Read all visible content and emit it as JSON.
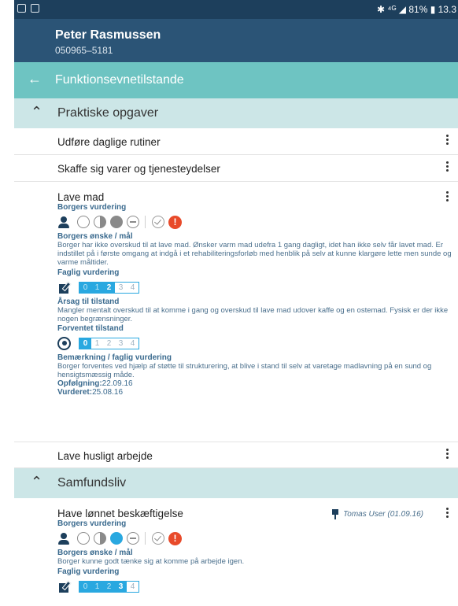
{
  "statusbar": {
    "right": "✱ ⁴ᴳ ◢ 81% ▮ 13.3"
  },
  "patient": {
    "name": "Peter Rasmussen",
    "cpr": "050965–5181"
  },
  "appbar": {
    "title": "Funktionsevnetilstande"
  },
  "sections": [
    {
      "label": "Praktiske opgaver"
    },
    {
      "label": "Samfundsliv"
    }
  ],
  "rows": {
    "daglige": "Udføre daglige rutiner",
    "varer": "Skaffe sig varer og tjenesteydelser",
    "husligt": "Lave husligt arbejde"
  },
  "lave_mad": {
    "title": "Lave mad",
    "borgers_vurdering": "Borgers vurdering",
    "onske_label": "Borgers ønske / mål",
    "onske_text": "Borger har ikke overskud til at lave mad. Ønsker varm mad udefra 1 gang dagligt, idet han ikke selv får lavet mad. Er indstillet på i første omgang at indgå i et rehabiliteringsforløb med henblik på selv at kunne klargøre lette men sunde og varme måltider.",
    "faglig_label": "Faglig vurdering",
    "faglig_scale": [
      "0",
      "1",
      "2",
      "3",
      "4"
    ],
    "faglig_value": 2,
    "aarsag_label": "Årsag til tilstand",
    "aarsag_text": "Mangler mentalt overskud til at komme i gang og overskud til lave mad udover kaffe og en ostemad. Fysisk er der ikke nogen begrænsninger.",
    "forventet_label": "Forventet tilstand",
    "forventet_value": 0,
    "bemaerk_label": "Bemærkning / faglig vurdering",
    "bemaerk_text": "Borger forventes ved hjælp af støtte til strukturering, at blive i stand til selv at varetage madlavning på en sund og hensigtsmæssig måde.",
    "opfolgning_label": "Opfølgning:",
    "opfolgning_date": "22.09.16",
    "vurderet_label": "Vurderet:",
    "vurderet_date": "25.08.16",
    "selected_circle": "full-grey"
  },
  "have_lonnet": {
    "title": "Have lønnet beskæftigelse",
    "pinned_by": "Tomas User (01.09.16)",
    "borgers_vurdering": "Borgers vurdering",
    "onske_label": "Borgers ønske / mål",
    "onske_text": "Borger kunne godt tænke sig at komme på arbejde igen.",
    "faglig_label": "Faglig vurdering",
    "faglig_value": 3,
    "selected_circle": "full-blue"
  },
  "colors": {
    "header": "#2b5476",
    "appbar": "#6ec4c2",
    "section": "#cce6e7",
    "accent": "#29a8e0",
    "alert": "#e84a2a"
  }
}
